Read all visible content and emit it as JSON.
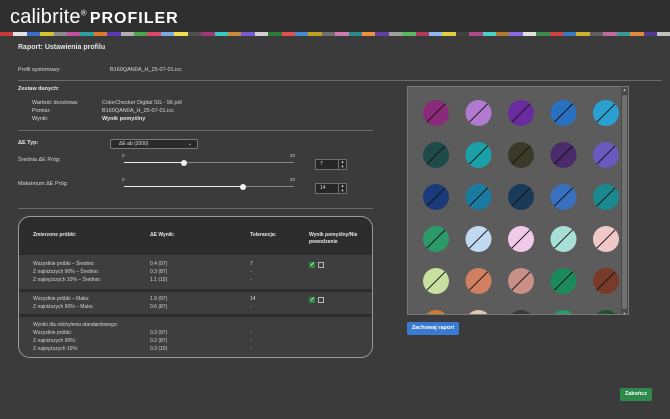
{
  "app": {
    "brand": "calibrite",
    "product": "PROFILER",
    "reg": "®"
  },
  "strip_colors": [
    "#c93a3a",
    "#e2e2e2",
    "#3a6fc9",
    "#d9c230",
    "#8a8a8a",
    "#c04f9e",
    "#2aa0a0",
    "#e07a2b",
    "#5a3ab0",
    "#b0b0b0",
    "#46a84a",
    "#d94a6a",
    "#7aa8e0",
    "#f0e050",
    "#505050",
    "#9e3a7a",
    "#3ac9c0",
    "#c9893a",
    "#7a5ad0",
    "#d0d0d0",
    "#2e7a3a",
    "#e05050",
    "#4a8ad0",
    "#c0a020",
    "#707070",
    "#d07ab0",
    "#2a8a8a",
    "#f09040",
    "#6040a0",
    "#a0a0a0",
    "#5ab85e",
    "#b03a5a",
    "#90b8f0",
    "#e0d040",
    "#404040",
    "#ae4a8a",
    "#4ad0c8",
    "#b07a30",
    "#8a6ae0",
    "#e0e0e0",
    "#3e8a4a",
    "#d04040",
    "#3a7ac0",
    "#d0b030",
    "#606060",
    "#c06aa0",
    "#3a9a9a",
    "#e08a3a",
    "#503a90",
    "#c0c0c0"
  ],
  "report": {
    "title": "Raport: Ustawienia profilu",
    "system_profile_label": "Profil systemowy:",
    "system_profile_value": "B160QAN0A_H_25-07-01.icc",
    "dataset_heading": "Zestaw danych:",
    "reference_label": "Wartość docelowa:",
    "reference_value": "ColorChecker Digital SG - 96 pól",
    "measurement_label": "Pomiar:",
    "measurement_value": "B160QAN0A_H_25-07-01.icc",
    "result_label": "Wynik:",
    "result_value": "Wynik pomyślny"
  },
  "settings": {
    "de_type_label": "ΔE Typ:",
    "de_type_value": "ΔE ab (2000)",
    "avg_label": "Średnia ΔE Próg:",
    "avg_min": "0",
    "avg_max": "20",
    "avg_value": "7",
    "avg_fraction": 0.35,
    "max_label": "Maksimum ΔE Próg:",
    "max_min": "0",
    "max_max": "20",
    "max_value": "14",
    "max_fraction": 0.7
  },
  "table": {
    "headers": {
      "samples": "Zmierzone próbki:",
      "result": "ΔE Wynik:",
      "tolerance": "Tolerancja:",
      "pass": "Wynik pomyślny/Nie powodzenie"
    },
    "groups": [
      {
        "rows": [
          {
            "label": "Wszystkie próbki – Średnio:",
            "value": "0.4 (97)",
            "tolerance": "7"
          },
          {
            "label": "Z najniższych 90% – Średnio:",
            "value": "0.3 (87)",
            "tolerance": "-"
          },
          {
            "label": "Z najwyższych 10% – Średnio:",
            "value": "1.1 (10)",
            "tolerance": "-"
          }
        ],
        "pass": true
      },
      {
        "rows": [
          {
            "label": "Wszystkie próbki – Maks:",
            "value": "1.9 (97)",
            "tolerance": "14"
          },
          {
            "label": "Z najniższych 90% – Maks:",
            "value": "0.6 (87)",
            "tolerance": "-"
          }
        ],
        "pass": true
      },
      {
        "title": "Wyniki dla odchylenia standardowego:",
        "rows": [
          {
            "label": "Wszystkie próbki:",
            "value": "0.3 (97)",
            "tolerance": "-"
          },
          {
            "label": "Z najniższych 90%:",
            "value": "0.2 (87)",
            "tolerance": "-"
          },
          {
            "label": "Z najwyższych 10%:",
            "value": "0.3 (10)",
            "tolerance": "-"
          }
        ]
      }
    ]
  },
  "swatches": [
    [
      "#8a2a7a",
      "#8a2a7a"
    ],
    [
      "#b07ad0",
      "#b07ad0"
    ],
    [
      "#6a2aa0",
      "#6a2aa0"
    ],
    [
      "#2a70c0",
      "#2a70c0"
    ],
    [
      "#2aa0d0",
      "#2aa0d0"
    ],
    [
      "#1e4a4a",
      "#1e4a4a"
    ],
    [
      "#1aa0a8",
      "#1aa0a8"
    ],
    [
      "#3a3a28",
      "#3a3a28"
    ],
    [
      "#4a2a6a",
      "#4a2a6a"
    ],
    [
      "#6a5ac0",
      "#6a5ac0"
    ],
    [
      "#1a3a7a",
      "#1a3a7a"
    ],
    [
      "#1a7aa0",
      "#1a7aa0"
    ],
    [
      "#1a3a5a",
      "#1a3a5a"
    ],
    [
      "#3a70c0",
      "#3a70c0"
    ],
    [
      "#1a8a90",
      "#1a8a90"
    ],
    [
      "#2a9a6a",
      "#2a9a6a"
    ],
    [
      "#c0d8f0",
      "#c0d8f0"
    ],
    [
      "#f0c8e8",
      "#f0c8e8"
    ],
    [
      "#a8e0d8",
      "#a8e0d8"
    ],
    [
      "#f0c8c8",
      "#f0c8c8"
    ],
    [
      "#c8e0a0",
      "#c8e0a0"
    ],
    [
      "#d08060",
      "#d08060"
    ],
    [
      "#c89088",
      "#c89088"
    ],
    [
      "#1a8a5a",
      "#1a8a5a"
    ],
    [
      "#7a3a2a",
      "#7a3a2a"
    ],
    [
      "#d07a30",
      "#d07a30"
    ],
    [
      "#e0c8b0",
      "#e0c8b0"
    ],
    [
      "#3a3a3a",
      "#3a3a3a"
    ],
    [
      "#2a9a6a",
      "#2a9a6a"
    ],
    [
      "#205030",
      "#205030"
    ]
  ],
  "buttons": {
    "save": "Zachowaj raport",
    "finish": "Zakończ",
    "save_color": "#3a7ad0",
    "finish_color": "#2e8a4a"
  }
}
